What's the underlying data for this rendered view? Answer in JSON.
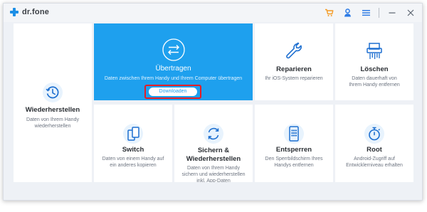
{
  "app": {
    "name": "dr.fone"
  },
  "colors": {
    "accent": "#1ea0ee",
    "highlight_frame": "#e41d25",
    "toolbar_cart": "#f59a23",
    "toolbar_icons": "#2d7be5"
  },
  "titlebar": {
    "icons": [
      "cart-icon",
      "user-icon",
      "menu-icon",
      "minimize-icon",
      "close-icon"
    ]
  },
  "features": {
    "restore": {
      "title": "Wiederherstellen",
      "desc": "Daten von Ihrem Handy wiederherstellen",
      "icon": "clock-restore-icon"
    },
    "transfer": {
      "title": "Übertragen",
      "desc": "Daten zwischen Ihrem Handy und Ihrem Computer übertragen",
      "button": "Downloaden",
      "icon": "transfer-arrows-icon"
    },
    "repair": {
      "title": "Reparieren",
      "desc": "Ihr iOS-System reparieren",
      "icon": "wrench-icon"
    },
    "erase": {
      "title": "Löschen",
      "desc": "Daten dauerhaft von Ihrem Handy entfernen",
      "icon": "shredder-icon"
    },
    "switch": {
      "title": "Switch",
      "desc": "Daten von einem Handy auf ein anderes kopieren",
      "icon": "phone-switch-icon"
    },
    "backup": {
      "title": "Sichern & Wiederherstellen",
      "desc": "Daten von Ihrem Handy sichern und wiederherstellen inkl. App-Daten",
      "icon": "sync-icon"
    },
    "unlock": {
      "title": "Entsperren",
      "desc": "Den Sperrbildschirm Ihres Handys entfernen",
      "icon": "phone-keypad-icon"
    },
    "root": {
      "title": "Root",
      "desc": "Android-Zugriff auf Entwicklerniveau erhalten",
      "icon": "stopwatch-icon"
    }
  }
}
